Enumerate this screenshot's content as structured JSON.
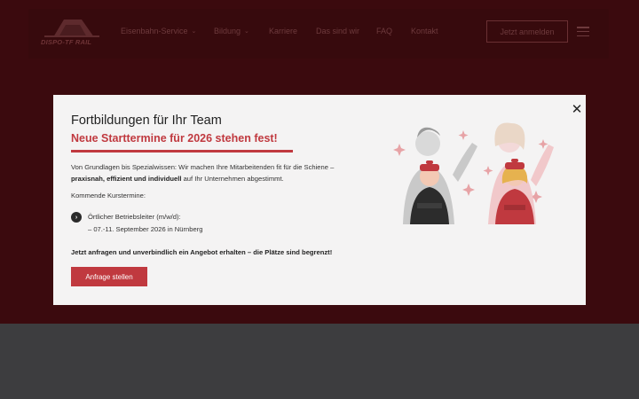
{
  "header": {
    "logo_text": "DISPO-TF RAIL",
    "nav": [
      {
        "label": "Eisenbahn-Service",
        "has_dropdown": true
      },
      {
        "label": "Bildung",
        "has_dropdown": true
      },
      {
        "label": "Karriere",
        "has_dropdown": false
      },
      {
        "label": "Das sind wir",
        "has_dropdown": false
      },
      {
        "label": "FAQ",
        "has_dropdown": false
      },
      {
        "label": "Kontakt",
        "has_dropdown": false
      }
    ],
    "login_label": "Jetzt anmelden",
    "menu_icon": "hamburger-icon"
  },
  "modal": {
    "title": "Fortbildungen für Ihr Team",
    "subtitle": "Neue Starttermine für 2026 stehen fest!",
    "intro_part1": "Von Grundlagen bis Spezialwissen: Wir machen Ihre Mitarbeitenden fit für die Schiene –",
    "intro_bold": "praxisnah, effizient und individuell",
    "intro_part2": " auf Ihr Unternehmen abgestimmt.",
    "courses_label": "Kommende Kurstermine:",
    "course_title": "Örtlicher Betriebsleiter (m/w/d):",
    "course_date": "– 07.-11. September 2026 in Nürnberg",
    "cta_text": "Jetzt anfragen und unverbindlich ein Angebot erhalten – die Plätze sind begrenzt!",
    "button_label": "Anfrage stellen",
    "close_icon": "close-icon"
  },
  "colors": {
    "accent": "#c0393f",
    "backdrop": "#3b0a0e",
    "modal_bg": "#f4f3f3"
  }
}
